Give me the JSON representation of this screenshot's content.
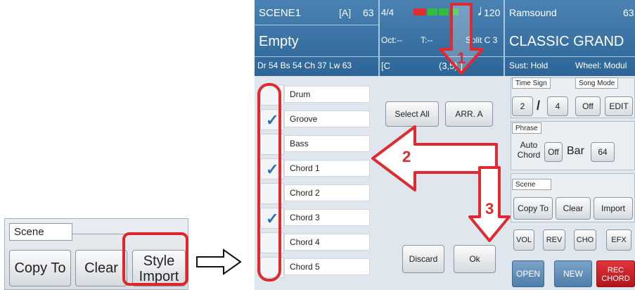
{
  "inset": {
    "scene_label": "Scene",
    "copy_to": "Copy To",
    "clear": "Clear",
    "import_line1": "Style",
    "import_line2": "Import"
  },
  "status": {
    "scene_name": "SCENE1",
    "scene_bank": "[A]",
    "scene_num": "63",
    "scene_title": "Empty",
    "mix": "Dr 54  Bs 54  Ch 37  Lw 63",
    "time_sig": "4/4",
    "tempo": "120",
    "oct": "Oct:--",
    "transpose": "T:--",
    "split": "Split C 3",
    "chord": "[C",
    "pos": "(3,5) ]",
    "bank": "Ramsound",
    "prog": "63",
    "voice": "CLASSIC GRAND",
    "sustain": "Sust: Hold",
    "wheel": "Wheel: Modul"
  },
  "tracks": [
    {
      "label": "Drum",
      "checked": false
    },
    {
      "label": "Groove",
      "checked": true
    },
    {
      "label": "Bass",
      "checked": false
    },
    {
      "label": "Chord 1",
      "checked": true
    },
    {
      "label": "Chord 2",
      "checked": false
    },
    {
      "label": "Chord 3",
      "checked": true
    },
    {
      "label": "Chord 4",
      "checked": false
    },
    {
      "label": "Chord 5",
      "checked": false
    }
  ],
  "middle": {
    "select_all": "Select All",
    "arr_a": "ARR. A",
    "discard": "Discard",
    "ok": "Ok"
  },
  "right": {
    "time_sign_label": "Time Sign",
    "ts_num": "2",
    "ts_slash": "/",
    "ts_den": "4",
    "song_mode_label": "Song Mode",
    "song_mode_off": "Off",
    "edit": "EDIT",
    "phrase_label": "Phrase",
    "auto_chord_1": "Auto",
    "auto_chord_2": "Chord",
    "auto_chord_off": "Off",
    "bar_label": "Bar",
    "bar_value": "64",
    "scene_label": "Scene",
    "copy_to": "Copy To",
    "clear": "Clear",
    "import": "Import",
    "vol": "VOL",
    "rev": "REV",
    "cho": "CHO",
    "efx": "EFX",
    "open": "OPEN",
    "new": "NEW",
    "rec_1": "REC",
    "rec_2": "CHORD"
  },
  "annotations": [
    "1",
    "2",
    "3"
  ],
  "colors": {
    "annotation_red": "#e02a2f",
    "status_bar_blue": "#3a71a3",
    "check_blue": "#2e6fb1"
  }
}
